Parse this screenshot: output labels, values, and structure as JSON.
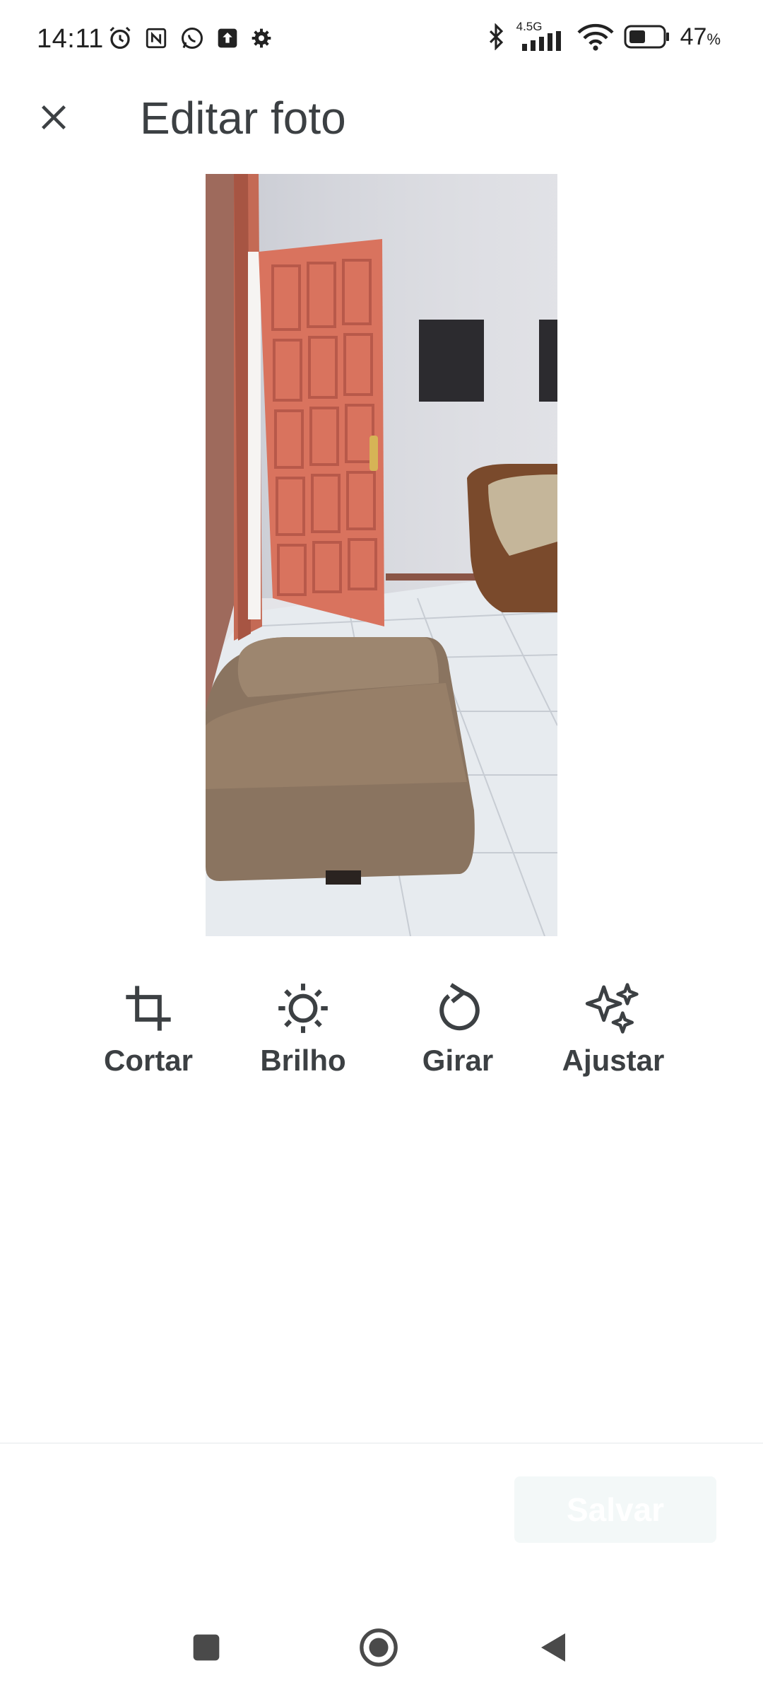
{
  "status_bar": {
    "time": "14:11",
    "network": "4.5G",
    "battery": "47",
    "battery_unit": "%",
    "left_icons": [
      "alarm-icon",
      "nfc-icon",
      "whatsapp-icon",
      "upload-icon",
      "settings-icon"
    ],
    "right_icons": [
      "bluetooth-icon",
      "signal-icon",
      "wifi-icon",
      "battery-icon"
    ]
  },
  "header": {
    "close_icon": "close-icon",
    "title": "Editar foto"
  },
  "photo": {
    "description_icon": "photo-preview"
  },
  "tools": [
    {
      "label": "Cortar",
      "icon": "crop-icon"
    },
    {
      "label": "Brilho",
      "icon": "brightness-icon"
    },
    {
      "label": "Girar",
      "icon": "rotate-icon"
    },
    {
      "label": "Ajustar",
      "icon": "sparkle-icon"
    }
  ],
  "footer": {
    "save_label": "Salvar",
    "save_enabled": false
  },
  "nav_bar": {
    "items": [
      "recents-square-icon",
      "home-circle-icon",
      "back-triangle-icon"
    ]
  },
  "colors": {
    "text": "#3c4043",
    "save_bg": "#f3f8f8",
    "door": "#d9735e",
    "sofa": "#8a7460"
  }
}
